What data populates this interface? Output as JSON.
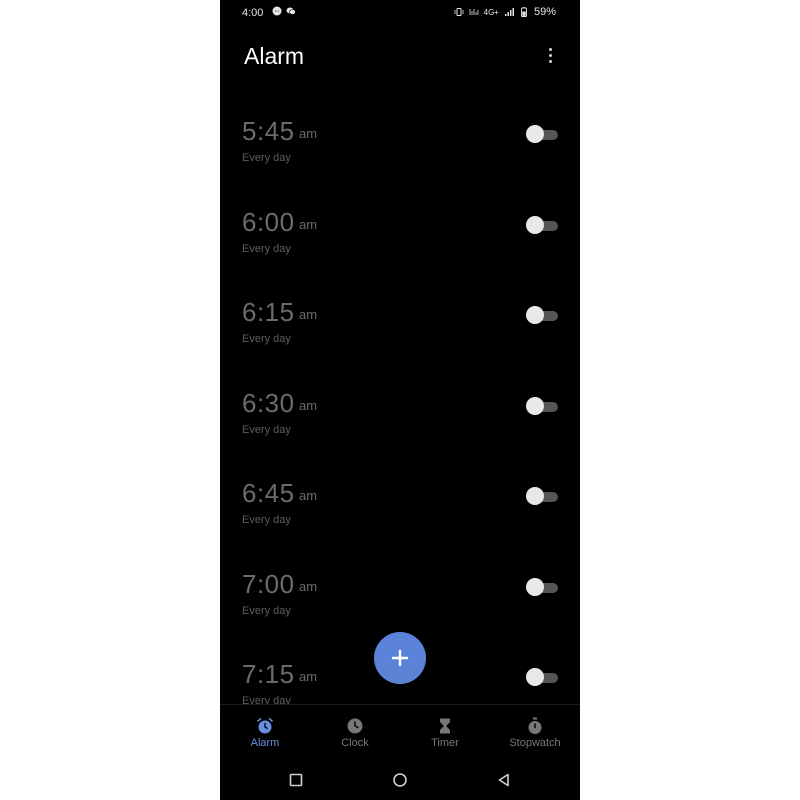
{
  "status_bar": {
    "time": "4:00",
    "network": "4G+",
    "battery": "59%"
  },
  "header": {
    "title": "Alarm"
  },
  "alarms": [
    {
      "time": "5:45",
      "ampm": "am",
      "repeat": "Every day",
      "enabled": false
    },
    {
      "time": "6:00",
      "ampm": "am",
      "repeat": "Every day",
      "enabled": false
    },
    {
      "time": "6:15",
      "ampm": "am",
      "repeat": "Every day",
      "enabled": false
    },
    {
      "time": "6:30",
      "ampm": "am",
      "repeat": "Every day",
      "enabled": false
    },
    {
      "time": "6:45",
      "ampm": "am",
      "repeat": "Every day",
      "enabled": false
    },
    {
      "time": "7:00",
      "ampm": "am",
      "repeat": "Every day",
      "enabled": false
    },
    {
      "time": "7:15",
      "ampm": "am",
      "repeat": "Every day",
      "enabled": false
    }
  ],
  "bottom_nav": {
    "items": [
      {
        "label": "Alarm",
        "icon": "alarm-icon",
        "active": true
      },
      {
        "label": "Clock",
        "icon": "clock-icon",
        "active": false
      },
      {
        "label": "Timer",
        "icon": "hourglass-icon",
        "active": false
      },
      {
        "label": "Stopwatch",
        "icon": "stopwatch-icon",
        "active": false
      }
    ]
  },
  "colors": {
    "background": "#000000",
    "accent": "#5b84d8",
    "muted_text": "#6b6b6b"
  }
}
